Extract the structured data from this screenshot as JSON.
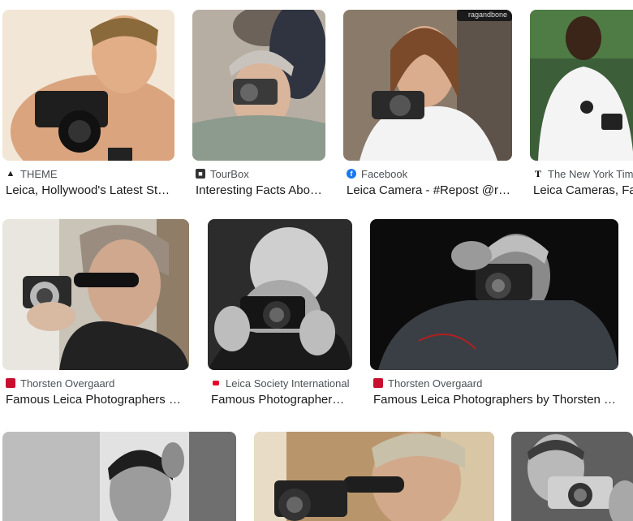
{
  "results": [
    {
      "source": "THEME",
      "favicon": "theme-icon",
      "favicon_color": "#222222",
      "title": "Leica, Hollywood's Latest St…"
    },
    {
      "source": "TourBox",
      "favicon": "tourbox-icon",
      "favicon_color": "#333333",
      "title": "Interesting Facts Abo…"
    },
    {
      "source": "Facebook",
      "favicon": "facebook-icon",
      "favicon_color": "#1877f2",
      "title": "Leica Camera - #Repost @r…"
    },
    {
      "source": "The New York Tim",
      "favicon": "nyt-icon",
      "favicon_color": "#ffffff",
      "title": "Leica Cameras, Fa"
    },
    {
      "source": "Thorsten Overgaard",
      "favicon": "thorsten-icon",
      "favicon_color": "#c8102e",
      "title": "Famous Leica Photographers …"
    },
    {
      "source": "Leica Society International",
      "favicon": "leica-society-icon",
      "favicon_color": "#e4002b",
      "title": "Famous Photographer…"
    },
    {
      "source": "Thorsten Overgaard",
      "favicon": "thorsten-icon",
      "favicon_color": "#c8102e",
      "title": "Famous Leica Photographers by Thorsten …"
    },
    {
      "source": "",
      "favicon": "",
      "favicon_color": "",
      "title": ""
    },
    {
      "source": "",
      "favicon": "",
      "favicon_color": "",
      "title": ""
    },
    {
      "source": "",
      "favicon": "",
      "favicon_color": "",
      "title": ""
    }
  ],
  "watermark": "ragandbone"
}
